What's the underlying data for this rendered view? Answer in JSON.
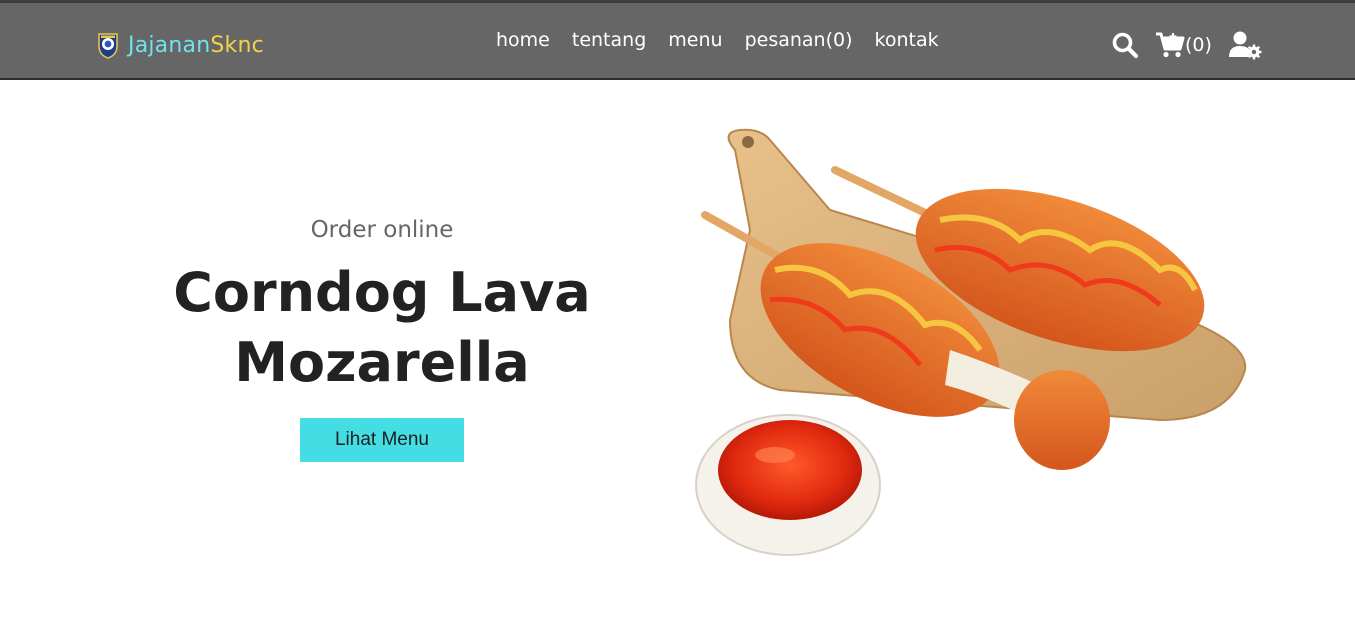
{
  "header": {
    "brand_part1": "Jajanan",
    "brand_part2": "Sknc",
    "nav": [
      {
        "label": "home"
      },
      {
        "label": "tentang"
      },
      {
        "label": "menu"
      },
      {
        "label": "pesanan(0)"
      },
      {
        "label": "kontak"
      }
    ],
    "cart_count": "(0)",
    "icons": [
      "school-logo-icon",
      "search-icon",
      "shopping-cart-icon",
      "user-settings-icon"
    ]
  },
  "hero": {
    "subtitle": "Order online",
    "title_line1": "Corndog Lava",
    "title_line2": "Mozarella",
    "button_label": "Lihat Menu"
  },
  "colors": {
    "header_bg": "#666666",
    "brand_part1": "#6fe3ee",
    "brand_part2": "#f3d34a",
    "button_bg": "#44dde4",
    "title": "#222222",
    "subtitle": "#666666"
  }
}
